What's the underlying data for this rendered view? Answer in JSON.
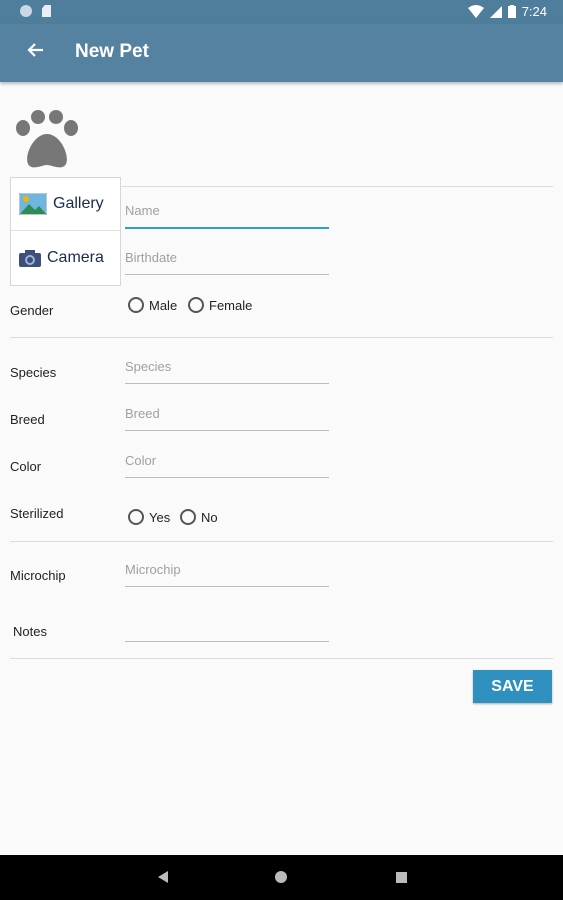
{
  "statusbar": {
    "time": "7:24"
  },
  "appbar": {
    "title": "New Pet"
  },
  "photo": {
    "gallery_label": "Gallery",
    "camera_label": "Camera"
  },
  "form": {
    "name_placeholder": "Name",
    "birthdate_placeholder": "Birthdate",
    "gender_label": "Gender",
    "gender_options": [
      "Male",
      "Female"
    ],
    "species_label": "Species",
    "species_placeholder": "Species",
    "breed_label": "Breed",
    "breed_placeholder": "Breed",
    "color_label": "Color",
    "color_placeholder": "Color",
    "sterilized_label": "Sterilized",
    "sterilized_options": [
      "Yes",
      "No"
    ],
    "microchip_label": "Microchip",
    "microchip_placeholder": "Microchip",
    "notes_label": "Notes",
    "notes_placeholder": ""
  },
  "actions": {
    "save_label": "SAVE"
  },
  "colors": {
    "appbar": "#5682a2",
    "accent": "#2c9fd3",
    "save_button": "#2f8fbf"
  }
}
